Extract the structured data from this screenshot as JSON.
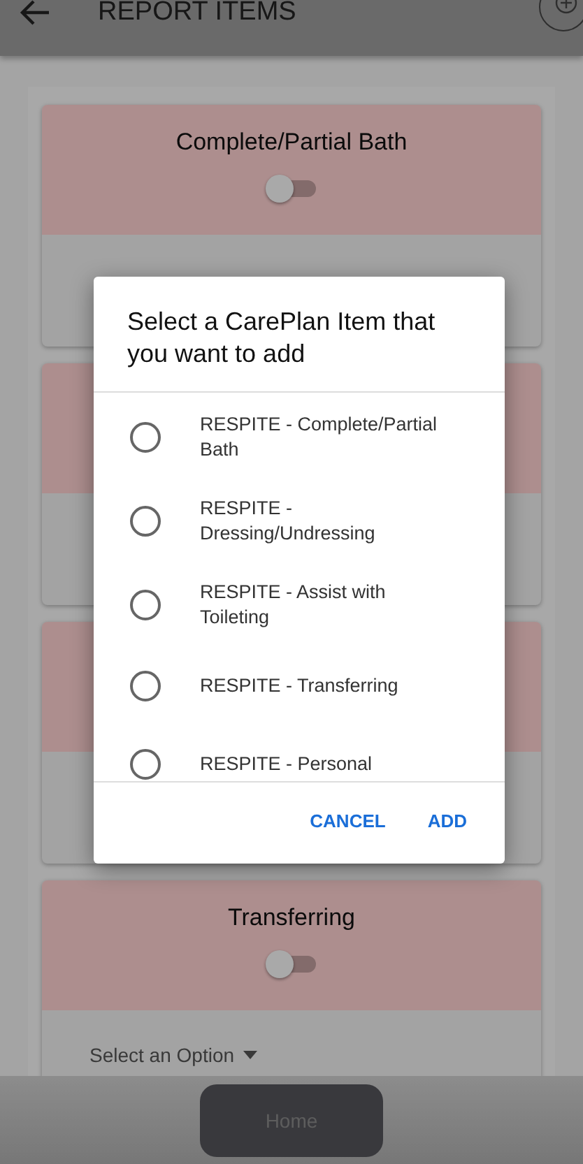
{
  "app_bar": {
    "title": "REPORT ITEMS"
  },
  "cards": [
    {
      "kind": "full",
      "title": "Complete/Partial Bath",
      "toggle_on": false
    },
    {
      "kind": "covered"
    },
    {
      "kind": "covered"
    },
    {
      "kind": "full",
      "title": "Transferring",
      "toggle_on": false,
      "option": "Select an Option"
    }
  ],
  "dialog": {
    "title": "Select a CarePlan Item that you want to add",
    "items": [
      {
        "label": "RESPITE - Complete/Partial Bath",
        "selected": false
      },
      {
        "label": "RESPITE - Dressing/Undressing",
        "selected": false
      },
      {
        "label": "RESPITE - Assist with Toileting",
        "selected": false
      },
      {
        "label": "RESPITE - Transferring",
        "selected": false
      },
      {
        "label": "RESPITE - Personal",
        "selected": false
      }
    ],
    "buttons": [
      "CANCEL",
      "ADD"
    ]
  },
  "bottom_bar": {
    "button": "Home"
  }
}
